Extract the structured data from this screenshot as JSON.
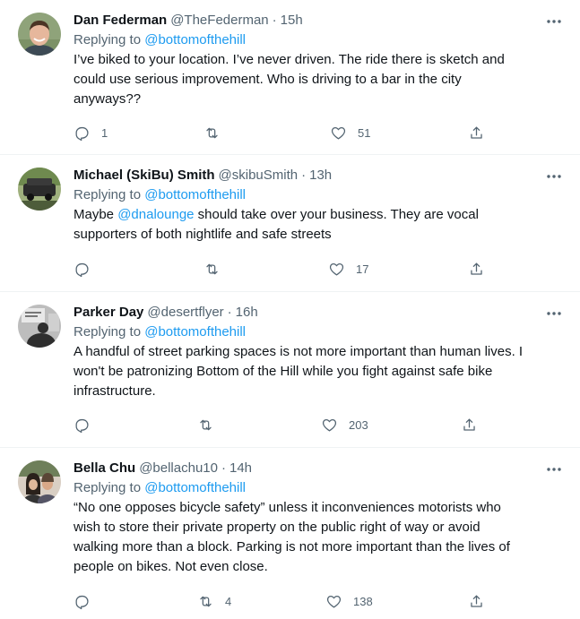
{
  "tweets": [
    {
      "name": "Dan Federman",
      "handle": "@TheFederman",
      "time": "15h",
      "replying_label": "Replying to",
      "replying_handle": "@bottomofthehill",
      "text_lines": [
        "I’ve biked to your location. I’ve never driven. The ride there is sketch and",
        "could use serious improvement. Who is driving to a bar in the city",
        "anyways??"
      ],
      "reply_count": "1",
      "retweet_count": "",
      "like_count": "51",
      "avatar_colors": {
        "bg": "#8fa37a",
        "skin": "#e6b79c",
        "hair": "#4a3424",
        "shirt": "#3d4a55"
      }
    },
    {
      "name": "Michael (SkiBu) Smith",
      "handle": "@skibuSmith",
      "time": "13h",
      "replying_label": "Replying to",
      "replying_handle": "@bottomofthehill",
      "text_pre": "Maybe ",
      "text_mention": "@dnalounge",
      "text_post": " should take over your business. They are vocal",
      "text_line2": "supporters of both nightlife and safe streets",
      "reply_count": "",
      "retweet_count": "",
      "like_count": "17",
      "avatar_colors": {
        "bg": "#6f8a4f",
        "car": "#2b2b2b",
        "sky": "#9fb07d"
      }
    },
    {
      "name": "Parker Day",
      "handle": "@desertflyer",
      "time": "16h",
      "replying_label": "Replying to",
      "replying_handle": "@bottomofthehill",
      "text_lines": [
        "A handful of street parking spaces is not more important than human lives. I",
        "won't be patronizing Bottom of the Hill while you fight against safe bike",
        "infrastructure."
      ],
      "reply_count": "",
      "retweet_count": "",
      "like_count": "203",
      "avatar_colors": {
        "bg": "#bdbdbd",
        "sign": "#e8e8e8",
        "figure": "#2e2e2e"
      }
    },
    {
      "name": "Bella Chu",
      "handle": "@bellachu10",
      "time": "14h",
      "replying_label": "Replying to",
      "replying_handle": "@bottomofthehill",
      "text_lines": [
        "“No one opposes bicycle safety” unless it inconveniences motorists who",
        "wish to store their private property on the public right of way or avoid",
        "walking more than a block. Parking is not more important than the lives of",
        "people on bikes. Not even close."
      ],
      "reply_count": "",
      "retweet_count": "4",
      "like_count": "138",
      "avatar_colors": {
        "bg": "#d9cfc4",
        "hair1": "#2a211b",
        "hair2": "#5a4636",
        "tree": "#6e7f5a"
      }
    }
  ],
  "dot": "·"
}
